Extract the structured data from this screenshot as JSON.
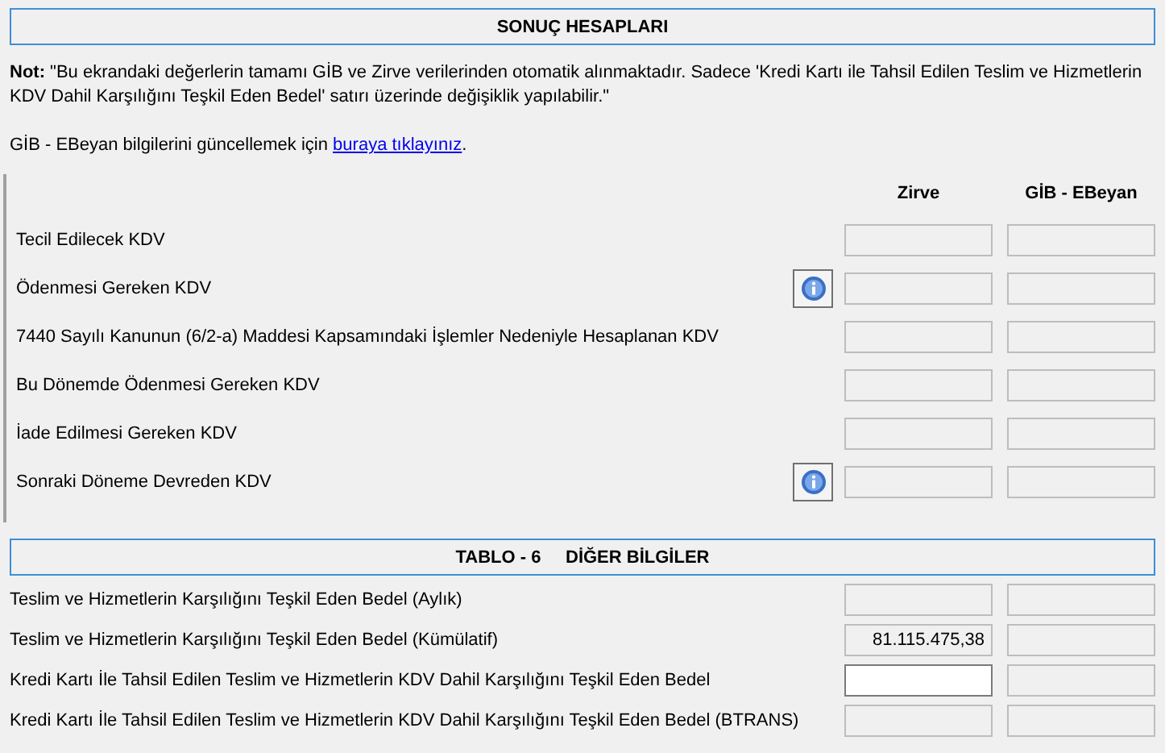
{
  "section_1": {
    "title": "SONUÇ HESAPLARI"
  },
  "note": "**Not:** \"Bu ekrandaki değerlerin tamamı GİB ve Zirve verilerinden otomatik alınmaktadır. Sadece 'Kredi Kartı ile Tahsil Edilen Teslim ve Hizmetlerin KDV Dahil Karşılığını Teşkil Eden Bedel' satırı üzerinde değişiklik yapılabilir.\"",
  "update_line": {
    "before": "GİB - EBeyan bilgilerini güncellemek için ",
    "link": "buraya tıklayınız",
    "after": "."
  },
  "columns": [
    "Zirve",
    "GİB - EBeyan"
  ],
  "results": [
    {
      "label": "Tecil Edilecek KDV",
      "info": false,
      "fields": [
        {
          "editable": false
        },
        {
          "editable": false
        }
      ]
    },
    {
      "label": "Ödenmesi Gereken KDV",
      "info": true,
      "fields": [
        {
          "editable": false
        },
        {
          "editable": false
        }
      ]
    },
    {
      "label": "7440 Sayılı Kanunun (6/2-a) Maddesi Kapsamındaki İşlemler Nedeniyle Hesaplanan KDV",
      "info": false,
      "fields": [
        {
          "editable": false
        },
        {
          "editable": false
        }
      ]
    },
    {
      "label": "Bu Dönemde Ödenmesi Gereken KDV",
      "info": false,
      "fields": [
        {
          "editable": false
        },
        {
          "editable": false
        }
      ]
    },
    {
      "label": "İade Edilmesi Gereken KDV",
      "info": false,
      "fields": [
        {
          "editable": false
        },
        {
          "editable": false
        }
      ]
    },
    {
      "label": "Sonraki Döneme Devreden KDV",
      "info": true,
      "fields": [
        {
          "editable": false
        },
        {
          "editable": false
        }
      ]
    }
  ],
  "section_2": {
    "title": "TABLO - 6     DİĞER BİLGİLER"
  },
  "other": [
    {
      "label": "Teslim ve Hizmetlerin Karşılığını Teşkil Eden Bedel (Aylık)",
      "info": false,
      "fields": [
        {
          "editable": false
        },
        {
          "editable": false
        }
      ]
    },
    {
      "label": "Teslim ve Hizmetlerin Karşılığını Teşkil Eden Bedel (Kümülatif)",
      "info": false,
      "fields": [
        {
          "value": "81.115.475,38",
          "editable": false
        },
        {
          "editable": false
        }
      ]
    },
    {
      "label": "Kredi Kartı İle Tahsil Edilen Teslim ve Hizmetlerin KDV Dahil Karşılığını Teşkil Eden Bedel",
      "info": false,
      "fields": [
        {
          "editable": true
        },
        {
          "editable": false
        }
      ]
    },
    {
      "label": "Kredi Kartı İle Tahsil Edilen Teslim ve Hizmetlerin KDV Dahil Karşılığını Teşkil Eden Bedel (BTRANS)",
      "info": false,
      "fields": [
        {
          "editable": false
        },
        {
          "editable": false
        }
      ]
    }
  ]
}
